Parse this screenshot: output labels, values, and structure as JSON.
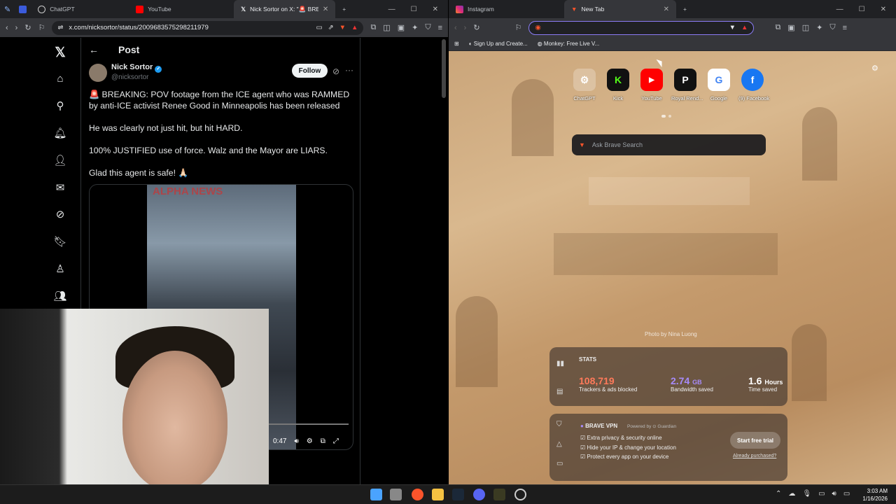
{
  "left_browser": {
    "tabs": [
      {
        "label": "ChatGPT"
      },
      {
        "label": "YouTube"
      },
      {
        "label": "Nick Sortor on X: \"🚨 BREA"
      }
    ],
    "url": "x.com/nicksortor/status/2009683575298211979",
    "x": {
      "page_title": "Post",
      "author_name": "Nick Sortor",
      "author_handle": "@nicksortor",
      "follow_label": "Follow",
      "post_lines": [
        "🚨 BREAKING: POV footage from the ICE agent who was RAMMED by anti-ICE activist Renee Good in Minneapolis has been released",
        "He was clearly not just hit, but hit HARD.",
        "100% JUSTIFIED use of force. Walz and the Mayor are LIARS.",
        "Glad this agent is safe! 🙏🏻"
      ],
      "video_watermark": "ALPHA NEWS",
      "video_time": "0:47"
    }
  },
  "right_browser": {
    "tabs": [
      {
        "label": "Instagram"
      },
      {
        "label": "New Tab"
      }
    ],
    "bookmarks": [
      {
        "label": "Sign Up and Create..."
      },
      {
        "label": "Monkey: Free Live V..."
      }
    ],
    "top_sites": [
      {
        "label": "ChatGPT",
        "glyph": "⚙",
        "color": "#ffffff"
      },
      {
        "label": "Kick",
        "glyph": "K",
        "color": "#53fc18"
      },
      {
        "label": "YouTube",
        "glyph": "▶",
        "color": "#ff0000"
      },
      {
        "label": "Royal Rend...",
        "glyph": "P",
        "color": "#ffffff"
      },
      {
        "label": "Google",
        "glyph": "G",
        "color": "#4285f4"
      },
      {
        "label": "(9) Facebook",
        "glyph": "f",
        "color": "#1877f2"
      }
    ],
    "search_placeholder": "Ask Brave Search",
    "photo_credit": "Photo by Nina Luong",
    "stats": {
      "heading": "STATS",
      "trackers_value": "108,719",
      "trackers_label": "Trackers & ads blocked",
      "bandwidth_value": "2.74",
      "bandwidth_unit": "GB",
      "bandwidth_label": "Bandwidth saved",
      "time_value": "1.6",
      "time_unit": "Hours",
      "time_label": "Time saved"
    },
    "vpn": {
      "title": "BRAVE VPN",
      "powered": "Powered by ⊙ Guardian",
      "features": [
        "Extra privacy & security online",
        "Hide your IP & change your location",
        "Protect every app on your device"
      ],
      "cta": "Start free trial",
      "link": "Already purchased?"
    }
  },
  "taskbar": {
    "time": "3:03 AM",
    "date": "1/16/2026"
  }
}
